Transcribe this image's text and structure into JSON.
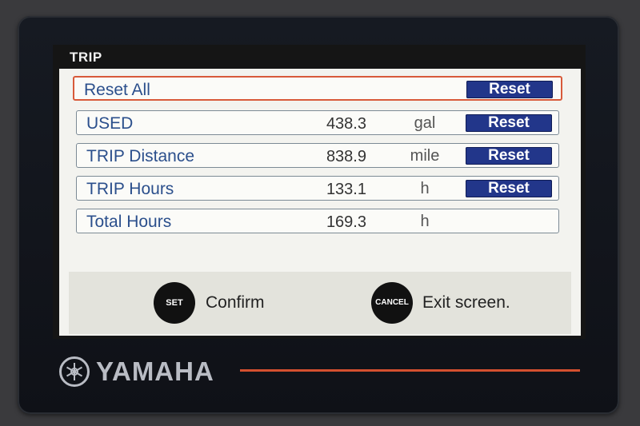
{
  "screen": {
    "title": "TRIP"
  },
  "rows": [
    {
      "label": "Reset All",
      "value": "",
      "unit": "",
      "button": "Reset",
      "selected": true
    },
    {
      "label": "USED",
      "value": "438.3",
      "unit": "gal",
      "button": "Reset"
    },
    {
      "label": "TRIP Distance",
      "value": "838.9",
      "unit": "mile",
      "button": "Reset"
    },
    {
      "label": "TRIP Hours",
      "value": "133.1",
      "unit": "h",
      "button": "Reset"
    },
    {
      "label": "Total Hours",
      "value": "169.3",
      "unit": "h",
      "button": ""
    }
  ],
  "footer": {
    "set_button": "SET",
    "set_label": "Confirm",
    "cancel_button": "CANCEL",
    "cancel_label": "Exit screen."
  },
  "brand": {
    "name": "YAMAHA",
    "icon": "tuning-fork-emblem-icon"
  },
  "colors": {
    "selection_border": "#d85a3a",
    "button_bg": "#22368a",
    "label_text": "#2b4f8c",
    "accent_line": "#d4502f"
  }
}
